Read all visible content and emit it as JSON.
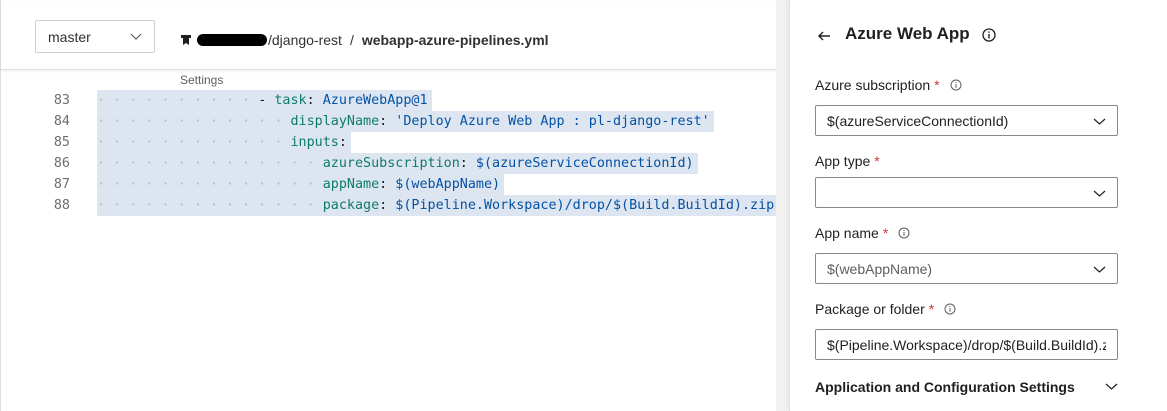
{
  "editor": {
    "branch": "master",
    "repo_suffix": "/django-rest",
    "path_separator": "/",
    "file_name": "webapp-azure-pipelines.yml",
    "settings_link": "Settings",
    "lines": [
      {
        "num": "83",
        "indent": "· · · · · · · · · · ",
        "parts": [
          {
            "t": "- ",
            "c": "dash"
          },
          {
            "t": "task",
            "c": "k"
          },
          {
            "t": ": ",
            "c": ""
          },
          {
            "t": "AzureWebApp@1",
            "c": "v"
          }
        ]
      },
      {
        "num": "84",
        "indent": "· · · · · · · · · · · · ",
        "parts": [
          {
            "t": "displayName",
            "c": "k"
          },
          {
            "t": ": ",
            "c": ""
          },
          {
            "t": "'Deploy Azure Web App : pl-django-rest'",
            "c": "v"
          }
        ]
      },
      {
        "num": "85",
        "indent": "· · · · · · · · · · · · ",
        "parts": [
          {
            "t": "inputs",
            "c": "k"
          },
          {
            "t": ":",
            "c": ""
          }
        ]
      },
      {
        "num": "86",
        "indent": "· · · · · · · · · · · · · · ",
        "parts": [
          {
            "t": "azureSubscription",
            "c": "k"
          },
          {
            "t": ": ",
            "c": ""
          },
          {
            "t": "$(azureServiceConnectionId)",
            "c": "v"
          }
        ]
      },
      {
        "num": "87",
        "indent": "· · · · · · · · · · · · · · ",
        "parts": [
          {
            "t": "appName",
            "c": "k"
          },
          {
            "t": ": ",
            "c": ""
          },
          {
            "t": "$(webAppName)",
            "c": "v"
          }
        ]
      },
      {
        "num": "88",
        "indent": "· · · · · · · · · · · · · · ",
        "parts": [
          {
            "t": "package",
            "c": "k"
          },
          {
            "t": ": ",
            "c": ""
          },
          {
            "t": "$(Pipeline.Workspace)/drop/$(Build.BuildId).zip",
            "c": "v"
          }
        ]
      }
    ]
  },
  "panel": {
    "title": "Azure Web App",
    "fields": {
      "subscription_label": "Azure subscription",
      "subscription_value": "$(azureServiceConnectionId)",
      "app_type_label": "App type",
      "app_type_value": "",
      "app_name_label": "App name",
      "app_name_placeholder": "$(webAppName)",
      "package_label": "Package or folder",
      "package_value": "$(Pipeline.Workspace)/drop/$(Build.BuildId).zip"
    },
    "required_mark": "*",
    "section_app_config": "Application and Configuration Settings"
  },
  "icons": {
    "back": "arrow-left-icon",
    "info": "info-icon",
    "chevron": "chevron-down-icon",
    "repo": "repo-icon"
  },
  "colors": {
    "required": "#d13438",
    "selection": "#dde6f0",
    "yaml_key": "#0e7a6d",
    "yaml_value": "#0451a5"
  }
}
